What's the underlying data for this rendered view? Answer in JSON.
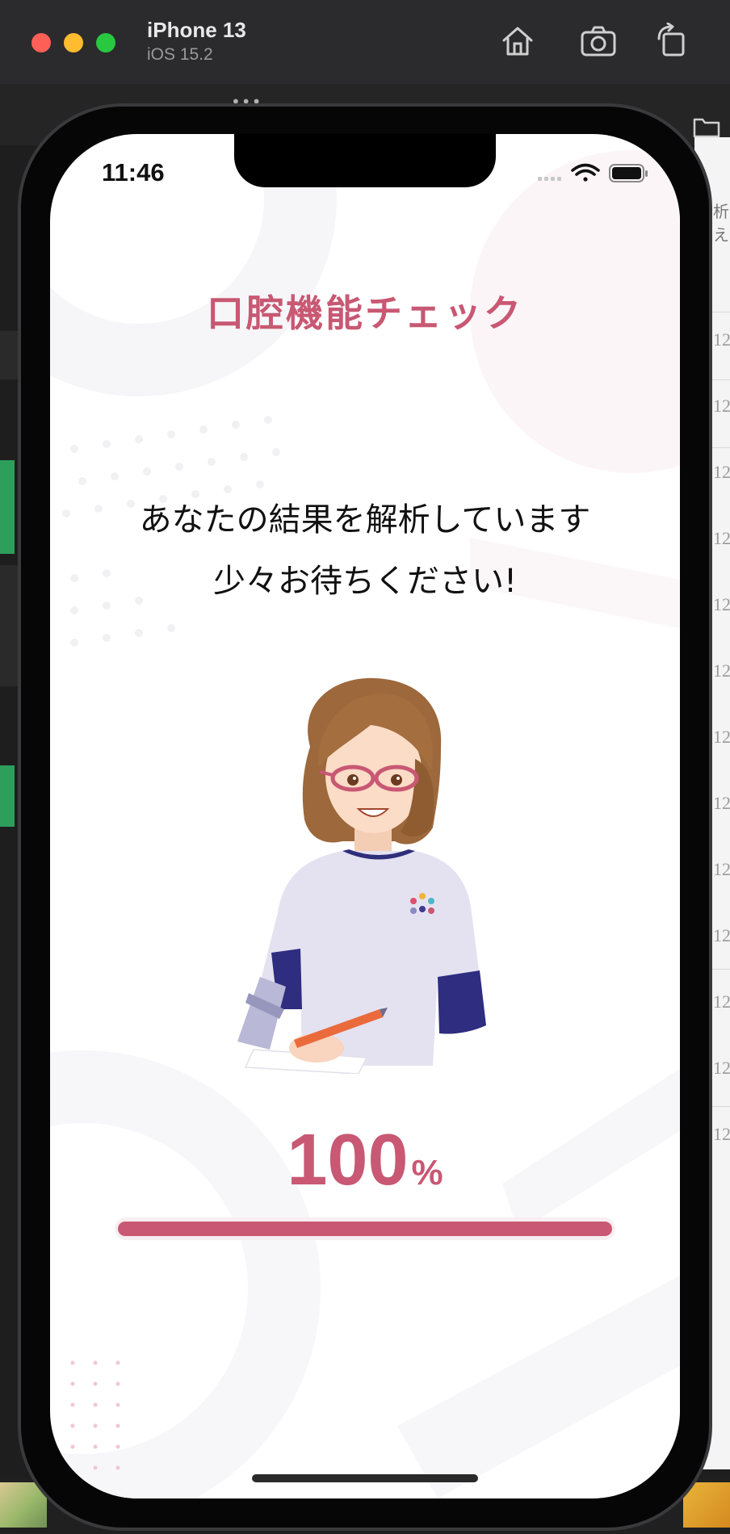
{
  "simulator": {
    "device_name": "iPhone 13",
    "os_version": "iOS 15.2",
    "toolbar": {
      "home_icon": "home-icon",
      "screenshot_icon": "camera-icon",
      "rotate_icon": "rotate-icon"
    }
  },
  "status_bar": {
    "time": "11:46",
    "icons": [
      "cellular-signal-icon",
      "wifi-icon",
      "battery-icon"
    ]
  },
  "app": {
    "title": "口腔機能チェック",
    "message_line1": "あなたの結果を解析しています",
    "message_line2": "少々お待ちください!",
    "illustration": "woman-with-glasses-writing-illustration",
    "progress": {
      "value": "100",
      "unit": "%",
      "fraction": 1.0
    }
  },
  "background_panel": {
    "row_number_text": "12",
    "top_text": "析え"
  },
  "colors": {
    "accent": "#c85873",
    "progress_track": "#f7eef1",
    "screen_background": "#ffffff",
    "status_text": "#111111"
  }
}
